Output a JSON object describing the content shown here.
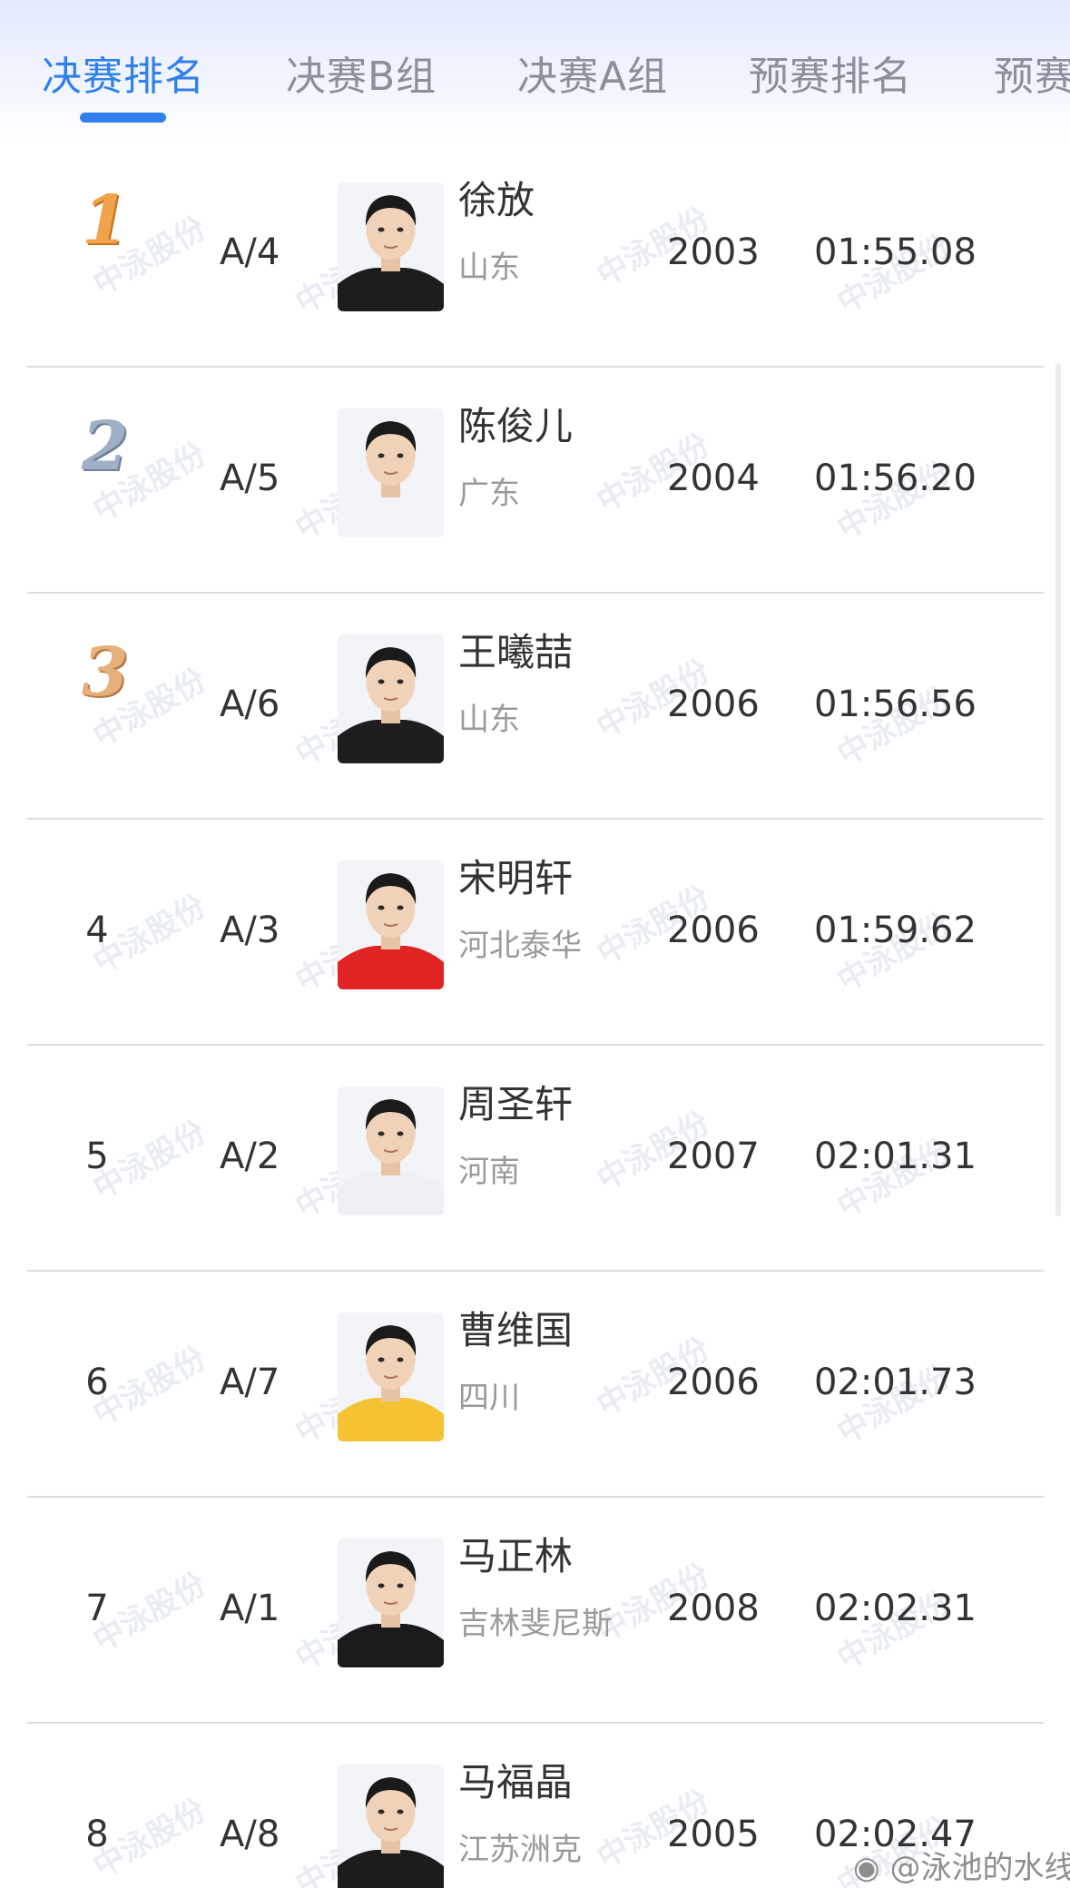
{
  "tabs": [
    {
      "label": "决赛排名",
      "active": true
    },
    {
      "label": "决赛B组"
    },
    {
      "label": "决赛A组"
    },
    {
      "label": "预赛排名"
    },
    {
      "label": "预赛"
    }
  ],
  "accent_color": "#2f80ed",
  "rows": [
    {
      "rank": "1",
      "medal": "gold",
      "lane": "A/4",
      "name": "徐放",
      "team": "山东",
      "year": "2003",
      "time": "01:55.08",
      "shirt": "#1d1d1f"
    },
    {
      "rank": "2",
      "medal": "silver",
      "lane": "A/5",
      "name": "陈俊儿",
      "team": "广东",
      "year": "2004",
      "time": "01:56.20",
      "shirt": "#f2f4f8"
    },
    {
      "rank": "3",
      "medal": "bronze",
      "lane": "A/6",
      "name": "王曦喆",
      "team": "山东",
      "year": "2006",
      "time": "01:56.56",
      "shirt": "#1e1e20"
    },
    {
      "rank": "4",
      "lane": "A/3",
      "name": "宋明轩",
      "team": "河北泰华",
      "year": "2006",
      "time": "01:59.62",
      "shirt": "#e02424"
    },
    {
      "rank": "5",
      "lane": "A/2",
      "name": "周圣轩",
      "team": "河南",
      "year": "2007",
      "time": "02:01.31",
      "shirt": "#eef0f6"
    },
    {
      "rank": "6",
      "lane": "A/7",
      "name": "曹维国",
      "team": "四川",
      "year": "2006",
      "time": "02:01.73",
      "shirt": "#f5c234"
    },
    {
      "rank": "7",
      "lane": "A/1",
      "name": "马正林",
      "team": "吉林斐尼斯",
      "year": "2008",
      "time": "02:02.31",
      "shirt": "#1b1b1d"
    },
    {
      "rank": "8",
      "lane": "A/8",
      "name": "马福晶",
      "team": "江苏洲克",
      "year": "2005",
      "time": "02:02.47",
      "shirt": "#1c1c1e"
    }
  ],
  "watermark_text": "中泳股份",
  "footer": {
    "weibo_icon": "weibo-icon",
    "handle": "@泳池的水线"
  }
}
